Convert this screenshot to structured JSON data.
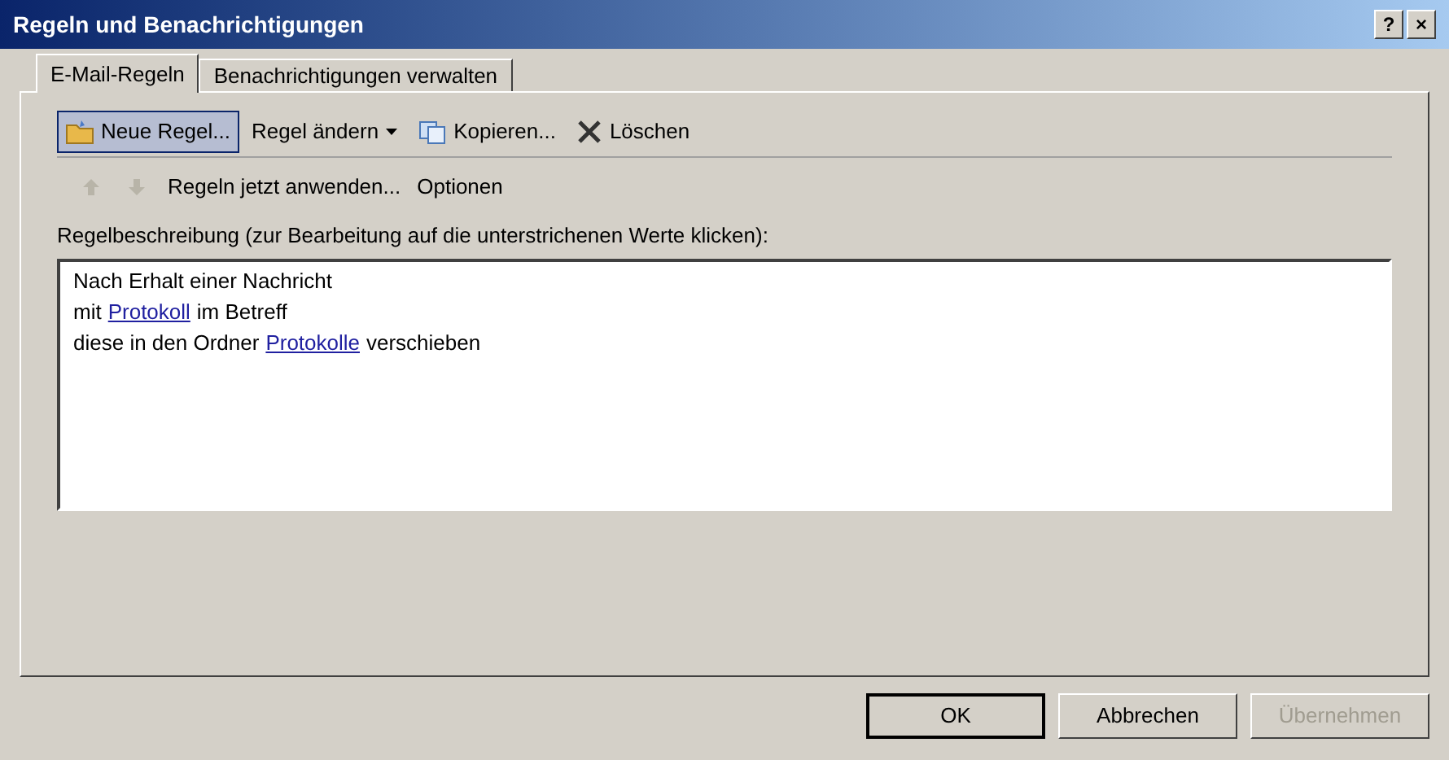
{
  "window": {
    "title": "Regeln und Benachrichtigungen",
    "title_buttons": [
      "?",
      "×"
    ]
  },
  "tabs": [
    {
      "label": "E-Mail-Regeln",
      "selected": true
    },
    {
      "label": "Benachrichtigungen verwalten",
      "selected": false
    }
  ],
  "toolbar": [
    {
      "kind": "new",
      "label": "Neue Regel...",
      "selected": true,
      "dropdown": false
    },
    {
      "kind": "plain",
      "label": "Regel ändern",
      "selected": false,
      "dropdown": true
    },
    {
      "kind": "copy",
      "label": "Kopieren...",
      "selected": false,
      "dropdown": false
    },
    {
      "kind": "delete",
      "label": "Löschen",
      "selected": false,
      "dropdown": false
    }
  ],
  "toolbar2": [
    {
      "kind": "up",
      "disabled": true
    },
    {
      "kind": "down",
      "disabled": true
    },
    {
      "kind": "text",
      "label": "Regeln jetzt anwenden...",
      "disabled": false
    },
    {
      "kind": "text",
      "label": "Optionen",
      "disabled": false
    }
  ],
  "description_label": "Regelbeschreibung (zur Bearbeitung auf die unterstrichenen Werte klicken):",
  "description": [
    [
      {
        "kind": "text",
        "text": "Nach Erhalt einer Nachricht"
      }
    ],
    [
      {
        "kind": "text",
        "text": "mit"
      },
      {
        "kind": "link",
        "text": "Protokoll"
      },
      {
        "kind": "text",
        "text": "im Betreff"
      }
    ],
    [
      {
        "kind": "text",
        "text": "diese in den Ordner"
      },
      {
        "kind": "link",
        "text": "Protokolle"
      },
      {
        "kind": "text",
        "text": "verschieben"
      }
    ]
  ],
  "buttons": [
    {
      "label": "OK",
      "default": true,
      "disabled": false
    },
    {
      "label": "Abbrechen",
      "default": false,
      "disabled": false
    },
    {
      "label": "Übernehmen",
      "default": false,
      "disabled": true
    }
  ]
}
